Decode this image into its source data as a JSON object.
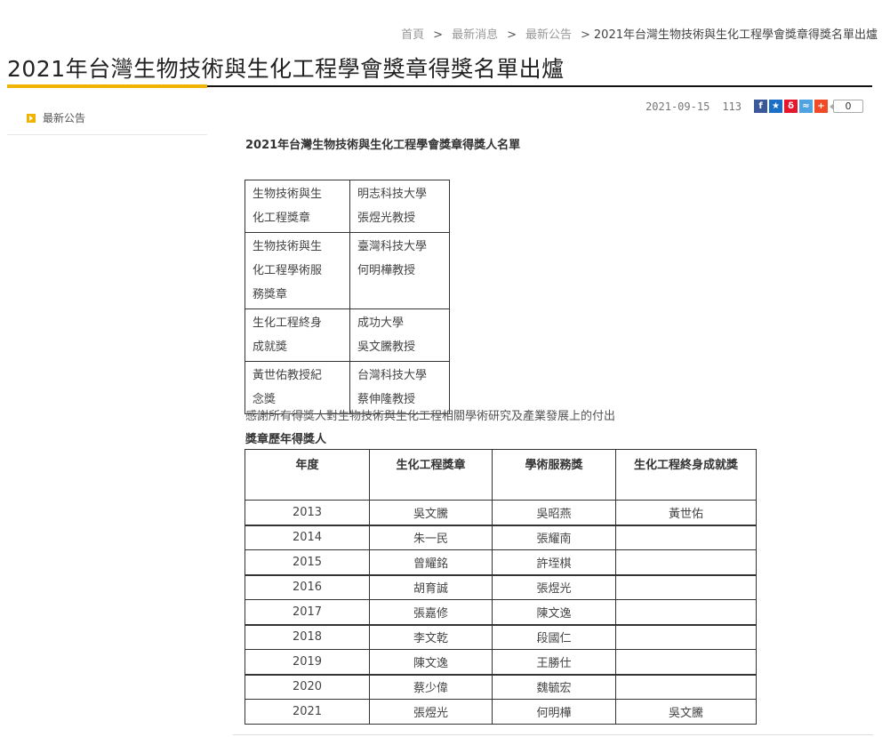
{
  "breadcrumb": {
    "home": "首頁",
    "news": "最新消息",
    "announcements": "最新公告",
    "current": "2021年台灣生物技術與生化工程學會獎章得獎名單出爐",
    "separator": ">"
  },
  "page_title": "2021年台灣生物技術與生化工程學會獎章得獎名單出爐",
  "sidebar": {
    "items": [
      {
        "label": "最新公告",
        "icon": "arrow-right-square-icon"
      }
    ]
  },
  "meta": {
    "date": "2021-09-15",
    "views": "113",
    "share_count": "0"
  },
  "share_buttons": [
    {
      "name": "facebook-share-button",
      "glyph": "f",
      "color": "#3b5998"
    },
    {
      "name": "plurk-share-button",
      "glyph": "★",
      "color": "#1b6fc7"
    },
    {
      "name": "weibo-share-button",
      "glyph": "δ",
      "color": "#e6162d"
    },
    {
      "name": "qq-share-button",
      "glyph": "≈",
      "color": "#4fa3e0"
    },
    {
      "name": "add-share-button",
      "glyph": "+",
      "color": "#f04b26"
    }
  ],
  "content": {
    "heading": "2021年台灣生物技術與生化工程學會獎章得獎人名單",
    "awards": [
      {
        "category_lines": [
          "生物技術與生",
          "化工程獎章"
        ],
        "winner_lines": [
          "明志科技大學",
          "張煜光教授"
        ]
      },
      {
        "category_lines": [
          "生物技術與生",
          "化工程學術服",
          "務獎章"
        ],
        "winner_lines": [
          "臺灣科技大學",
          "何明樺教授"
        ]
      },
      {
        "category_lines": [
          "生化工程終身",
          "成就獎"
        ],
        "winner_lines": [
          "成功大學",
          "吳文騰教授"
        ]
      },
      {
        "category_lines": [
          "黃世佑教授紀",
          "念獎"
        ],
        "winner_lines": [
          "台灣科技大學",
          "蔡伸隆教授"
        ]
      }
    ],
    "thanks": "感謝所有得獎人對生物技術與生化工程相關學術研究及產業發展上的付出",
    "history_heading": "獎章歷年得獎人",
    "history_table": {
      "headers": [
        "年度",
        "生化工程獎章",
        "學術服務獎",
        "生化工程終身成就獎"
      ],
      "rows": [
        [
          "2013",
          "吳文騰",
          "吳昭燕",
          "黃世佑"
        ],
        [
          "2014",
          "朱一民",
          "張耀南",
          ""
        ],
        [
          "2015",
          "曾耀銘",
          "許垤棋",
          ""
        ],
        [
          "2016",
          "胡育誠",
          "張煜光",
          ""
        ],
        [
          "2017",
          "張嘉修",
          "陳文逸",
          ""
        ],
        [
          "2018",
          "李文乾",
          "段國仁",
          ""
        ],
        [
          "2019",
          "陳文逸",
          "王勝仕",
          ""
        ],
        [
          "2020",
          "蔡少偉",
          "魏毓宏",
          ""
        ],
        [
          "2021",
          "張煜光",
          "何明樺",
          "吳文騰"
        ]
      ]
    }
  }
}
